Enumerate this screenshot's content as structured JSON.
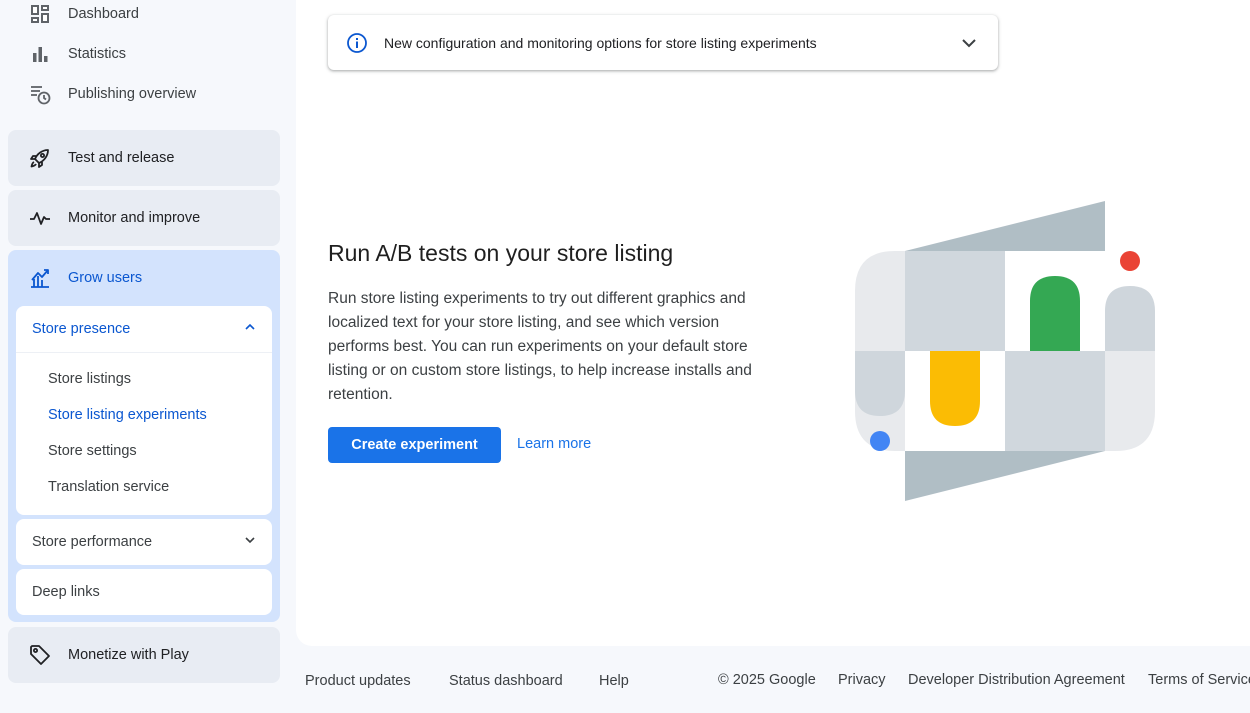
{
  "sidebar": {
    "top_items": [
      {
        "label": "Dashboard",
        "icon": "dashboard-icon"
      },
      {
        "label": "Statistics",
        "icon": "bar-chart-icon"
      },
      {
        "label": "Publishing overview",
        "icon": "publishing-overview-icon"
      }
    ],
    "sections": {
      "test_release": {
        "label": "Test and release",
        "icon": "rocket-icon"
      },
      "monitor": {
        "label": "Monitor and improve",
        "icon": "pulse-icon"
      },
      "grow": {
        "label": "Grow users",
        "icon": "grow-users-icon",
        "store_presence": {
          "label": "Store presence",
          "expanded": true,
          "items": [
            "Store listings",
            "Store listing experiments",
            "Store settings",
            "Translation service"
          ],
          "selected": "Store listing experiments"
        },
        "store_performance": {
          "label": "Store performance",
          "expanded": false
        },
        "deep_links": {
          "label": "Deep links"
        }
      },
      "monetize": {
        "label": "Monetize with Play",
        "icon": "tag-icon"
      }
    }
  },
  "banner": {
    "text": "New configuration and monitoring options for store listing experiments",
    "icon": "info-icon"
  },
  "hero": {
    "title": "Run A/B tests on your store listing",
    "description": "Run store listing experiments to try out different graphics and localized text for your store listing, and see which version performs best. You can run experiments on your default store listing or on custom store listings, to help increase installs and retention.",
    "primary_button": "Create experiment",
    "link": "Learn more"
  },
  "footer": {
    "links_left": [
      "Product updates",
      "Status dashboard",
      "Help"
    ],
    "copyright": "© 2025 Google",
    "links_right": [
      "Privacy",
      "Developer Distribution Agreement",
      "Terms of Service"
    ]
  },
  "colors": {
    "accent": "#1a73e8",
    "active_section_bg": "#d3e3fd",
    "section_bg": "#e8ecf3",
    "illustration_green": "#34a853",
    "illustration_yellow": "#fbbc04",
    "illustration_red": "#ea4335",
    "illustration_blue": "#4285f4"
  }
}
